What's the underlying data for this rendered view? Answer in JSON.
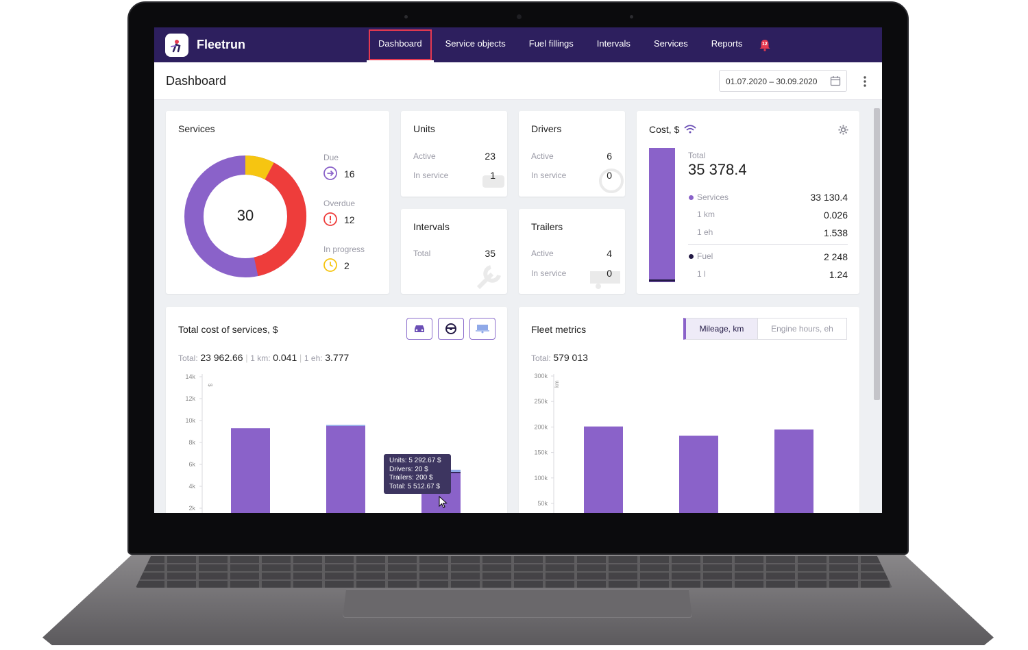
{
  "app": {
    "brand": "Fleetrun",
    "nav": [
      "Dashboard",
      "Service objects",
      "Fuel fillings",
      "Intervals",
      "Services",
      "Reports"
    ],
    "active_nav": "Dashboard",
    "notifications": "12"
  },
  "header": {
    "title": "Dashboard",
    "date_range": "01.07.2020 – 30.09.2020"
  },
  "services_card": {
    "title": "Services",
    "total": "30",
    "due_label": "Due",
    "due": "16",
    "overdue_label": "Overdue",
    "overdue": "12",
    "progress_label": "In progress",
    "progress": "2",
    "colors": {
      "due": "#8a62c9",
      "overdue": "#ee3d3b",
      "progress": "#f6c511"
    }
  },
  "units_card": {
    "title": "Units",
    "active_label": "Active",
    "active": "23",
    "service_label": "In service",
    "service": "1"
  },
  "drivers_card": {
    "title": "Drivers",
    "active_label": "Active",
    "active": "6",
    "service_label": "In service",
    "service": "0"
  },
  "intervals_card": {
    "title": "Intervals",
    "total_label": "Total",
    "total": "35"
  },
  "trailers_card": {
    "title": "Trailers",
    "active_label": "Active",
    "active": "4",
    "service_label": "In service",
    "service": "0"
  },
  "cost_card": {
    "title": "Cost, $",
    "total_label": "Total",
    "total": "35 378.4",
    "services_label": "Services",
    "services": "33 130.4",
    "km_label": "1 km",
    "km": "0.026",
    "eh_label": "1 eh",
    "eh": "1.538",
    "fuel_label": "Fuel",
    "fuel": "2 248",
    "l_label": "1 l",
    "l": "1.24"
  },
  "total_cost_card": {
    "title": "Total cost of services, $",
    "total_label": "Total:",
    "total": "23 962.66",
    "km_label": "1 km:",
    "km": "0.041",
    "eh_label": "1 eh:",
    "eh": "3.777",
    "tooltip": [
      "Units: 5 292.67 $",
      "Drivers: 20 $",
      "Trailers: 200 $",
      "Total: 5 512.67 $"
    ]
  },
  "fleet_card": {
    "title": "Fleet metrics",
    "tab_active": "Mileage, km",
    "tab_inactive": "Engine hours, eh",
    "total_label": "Total:",
    "total": "579 013"
  },
  "chart_data": [
    {
      "type": "bar",
      "title": "Total cost of services, $",
      "ylabel": "$",
      "yticks": [
        "14k",
        "12k",
        "10k",
        "8k",
        "6k",
        "4k",
        "2k"
      ],
      "ylim": [
        0,
        14000
      ],
      "series": [
        {
          "name": "Units",
          "values": [
            9300,
            9500,
            5292.67
          ]
        },
        {
          "name": "Drivers",
          "values": [
            0,
            0,
            20
          ]
        },
        {
          "name": "Trailers",
          "values": [
            0,
            100,
            200
          ]
        }
      ],
      "categories": [
        "",
        "",
        ""
      ]
    },
    {
      "type": "bar",
      "title": "Fleet metrics",
      "ylabel": "km",
      "yticks": [
        "300k",
        "250k",
        "200k",
        "150k",
        "100k",
        "50k"
      ],
      "ylim": [
        0,
        300000
      ],
      "values": [
        201000,
        183000,
        195000
      ],
      "categories": [
        "",
        "",
        ""
      ]
    }
  ]
}
